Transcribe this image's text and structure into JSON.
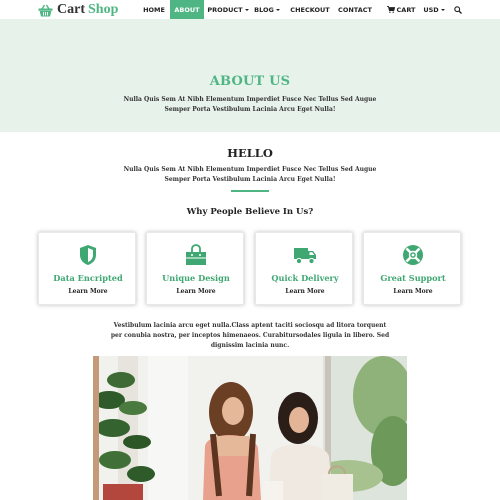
{
  "brand": {
    "word1": "Cart",
    "word2": "Shop",
    "accent": "#4fb683"
  },
  "nav": {
    "home": "HOME",
    "about": "ABOUT",
    "product": "PRODUCT",
    "blog": "BLOG",
    "checkout": "CHECKOUT",
    "contact": "CONTACT",
    "cart": "CART",
    "currency": "USD",
    "active": "ABOUT"
  },
  "hero": {
    "title": "ABOUT US",
    "text": "Nulla Quis Sem At Nibh Elementum Imperdiet Fusce Nec Tellus Sed Augue Semper Porta Vestibulum Lacinia Arcu Eget Nulla!",
    "background": "#e6f2ea"
  },
  "hello": {
    "title": "HELLO",
    "text": "Nulla Quis Sem At Nibh Elementum Imperdiet Fusce Nec Tellus Sed Augue Semper Porta Vestibulum Lacinia Arcu Eget Nulla!"
  },
  "why": {
    "title": "Why People Believe In Us?"
  },
  "features": [
    {
      "title": "Data Encripted",
      "link": "Learn More",
      "icon": "shield-icon"
    },
    {
      "title": "Unique Design",
      "link": "Learn More",
      "icon": "shopping-bag-icon"
    },
    {
      "title": "Quick Delivery",
      "link": "Learn More",
      "icon": "truck-icon"
    },
    {
      "title": "Great Support",
      "link": "Learn More",
      "icon": "lifebuoy-icon"
    }
  ],
  "about_text": "Vestibulum lacinia arcu eget nulla.Class aptent taciti sociosqu ad litora torquent per conubia nostra, per inceptos himenaeos. Curabitursodales ligula in libero. Sed dignissim lacinia nunc."
}
